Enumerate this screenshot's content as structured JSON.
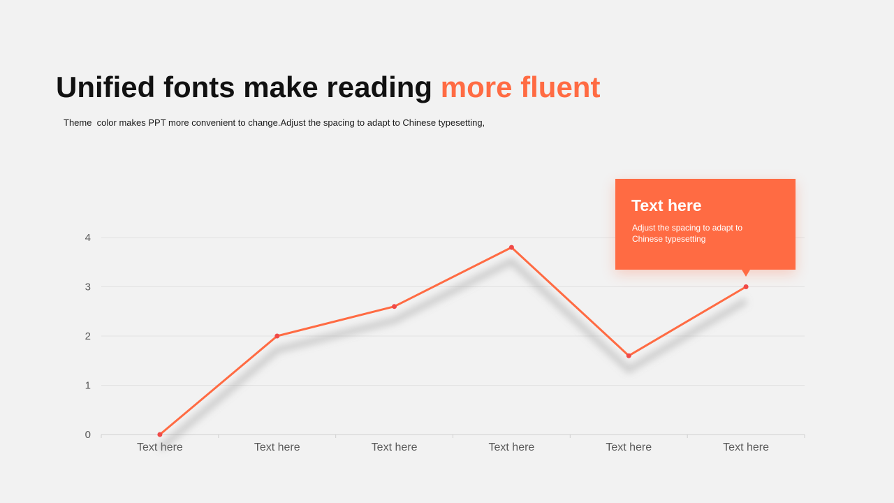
{
  "slide": {
    "title_main": "Unified fonts make reading ",
    "title_accent": "more fluent",
    "subtitle": "Theme  color makes PPT more convenient to change.Adjust the spacing to adapt to Chinese typesetting,",
    "accent_color": "#ff6b43"
  },
  "callout": {
    "title": "Text here",
    "text": "Adjust the spacing to adapt to Chinese typesetting"
  },
  "chart_data": {
    "type": "line",
    "categories": [
      "Text here",
      "Text here",
      "Text here",
      "Text here",
      "Text here",
      "Text here"
    ],
    "series": [
      {
        "values": [
          0,
          2.0,
          2.6,
          3.8,
          1.6,
          3.0
        ],
        "color": "#ff6b43"
      }
    ],
    "ylim": [
      0,
      4
    ],
    "yticks": [
      0,
      1,
      2,
      3,
      4
    ],
    "grid": true
  }
}
